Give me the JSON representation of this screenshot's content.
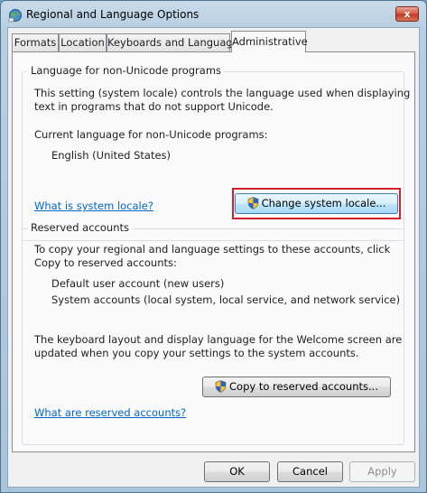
{
  "window": {
    "title": "Regional and Language Options",
    "close_glyph": "x"
  },
  "tabs": [
    {
      "label": "Formats",
      "active": false
    },
    {
      "label": "Location",
      "active": false
    },
    {
      "label": "Keyboards and Languages",
      "active": false
    },
    {
      "label": "Administrative",
      "active": true
    }
  ],
  "non_unicode": {
    "legend": "Language for non-Unicode programs",
    "description_line1": "This setting (system locale) controls the language used when displaying",
    "description_line2": "text in programs that do not support Unicode.",
    "current_label": "Current language for non-Unicode programs:",
    "current_value": "English (United States)",
    "change_button": "Change system locale...",
    "help_link": "What is system locale?"
  },
  "reserved": {
    "legend": "Reserved accounts",
    "description_line1": "To copy your regional and language settings to these accounts, click",
    "description_line2": "Copy to reserved accounts:",
    "account1": "Default user account (new users)",
    "account2": "System accounts (local system, local service, and network service)",
    "welcome_line1": "The keyboard layout and display language for the Welcome screen are",
    "welcome_line2": "updated when you copy your settings to the system accounts.",
    "copy_button": "Copy to reserved accounts...",
    "help_link": "What are reserved accounts?"
  },
  "footer": {
    "ok": "OK",
    "cancel": "Cancel",
    "apply": "Apply"
  },
  "icons": {
    "app": "globe-icon",
    "uac": "uac-shield-icon"
  },
  "colors": {
    "link": "#0066cc",
    "highlight": "#d4202a",
    "close_button": "#c03a24"
  }
}
